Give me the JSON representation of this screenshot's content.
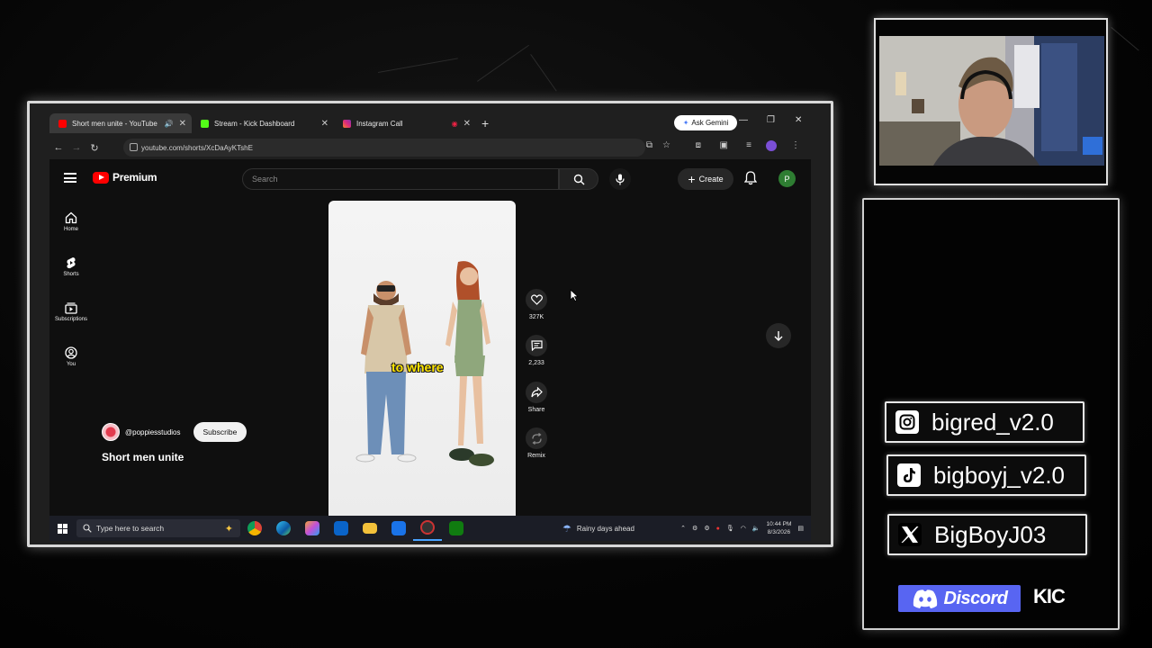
{
  "browser": {
    "tabs": [
      {
        "title": "Short men unite - YouTube",
        "favicon_color": "#ff0000",
        "active": true
      },
      {
        "title": "Stream - Kick Dashboard",
        "favicon_color": "#53fc18",
        "active": false
      },
      {
        "title": "Instagram Call",
        "favicon_color": "#e1306c",
        "active": false
      }
    ],
    "gemini_label": "Ask Gemini",
    "url": "youtube.com/shorts/XcDaAyKTshE"
  },
  "youtube": {
    "brand": "Premium",
    "search_placeholder": "Search",
    "create_label": "Create",
    "avatar_letter": "P",
    "sidebar": [
      {
        "label": "Home",
        "icon": "home-icon"
      },
      {
        "label": "Shorts",
        "icon": "shorts-icon"
      },
      {
        "label": "Subscriptions",
        "icon": "subscriptions-icon"
      },
      {
        "label": "You",
        "icon": "you-icon"
      }
    ],
    "short": {
      "caption": "to where",
      "channel": "@poppiesstudios",
      "subscribe_label": "Subscribe",
      "title": "Short men unite"
    },
    "actions": [
      {
        "label": "327K",
        "icon": "like-icon"
      },
      {
        "label": "2,233",
        "icon": "comment-icon"
      },
      {
        "label": "Share",
        "icon": "share-icon"
      },
      {
        "label": "Remix",
        "icon": "remix-icon"
      }
    ]
  },
  "taskbar": {
    "search_placeholder": "Type here to search",
    "weather": "Rainy days ahead",
    "time": "10:44 PM",
    "date": "8/3/2026"
  },
  "overlay": {
    "socials": [
      {
        "platform": "instagram",
        "handle": "bigred_v2.0"
      },
      {
        "platform": "tiktok",
        "handle": "bigboyj_v2.0"
      },
      {
        "platform": "x",
        "handle": "BigBoyJ03"
      }
    ],
    "discord_label": "Discord",
    "kick_label": "KIC"
  },
  "colors": {
    "youtube_red": "#ff0000",
    "discord_blurple": "#5865f2",
    "kick_green": "#53fc18",
    "caption_yellow": "#ffe500"
  }
}
